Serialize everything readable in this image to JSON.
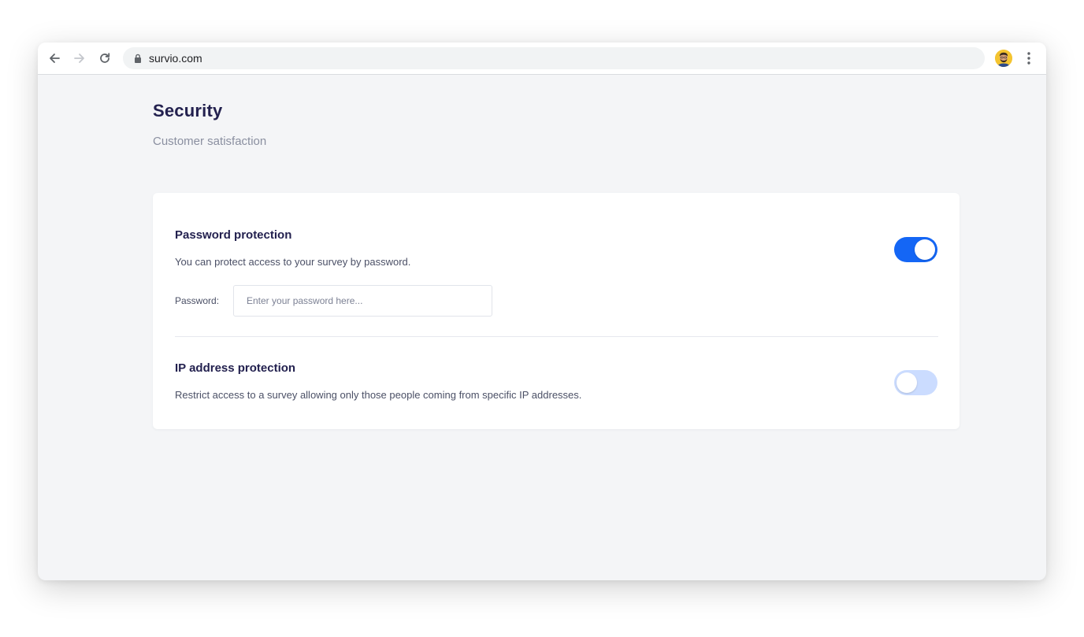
{
  "browser": {
    "url": "survio.com",
    "back_icon": "arrow-left-icon",
    "forward_icon": "arrow-right-icon",
    "reload_icon": "reload-icon",
    "lock_icon": "lock-icon",
    "menu_icon": "more-vertical-icon"
  },
  "page": {
    "title": "Security",
    "subtitle": "Customer satisfaction"
  },
  "settings": {
    "password": {
      "title": "Password protection",
      "description": "You can protect access to your survey by password.",
      "field_label": "Password:",
      "placeholder": "Enter your password here...",
      "value": "",
      "enabled": true
    },
    "ip": {
      "title": "IP address protection",
      "description": "Restrict access to a survey allowing only those people coming from specific IP addresses.",
      "enabled": false
    }
  },
  "colors": {
    "accent": "#1466f5",
    "accent_light": "#cbdcff",
    "heading": "#23214f",
    "muted": "#8a8fa0",
    "background": "#f4f5f7"
  }
}
